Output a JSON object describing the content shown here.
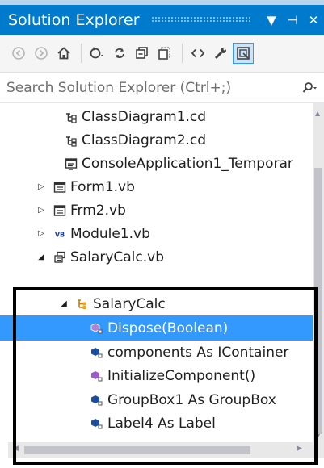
{
  "panel": {
    "title": "Solution Explorer",
    "dropdown_glyph": "▼",
    "pin_glyph": "⊣",
    "close_glyph": "✕",
    "accent_color": "#007acc",
    "selection_color": "#3399ff"
  },
  "toolbar": {
    "items": [
      {
        "name": "back-icon"
      },
      {
        "name": "forward-icon"
      },
      {
        "name": "home-icon"
      },
      {
        "name": "pending-changes-icon"
      },
      {
        "name": "sync-icon"
      },
      {
        "name": "collapse-all-icon"
      },
      {
        "name": "show-all-files-icon"
      },
      {
        "name": "view-code-icon"
      },
      {
        "name": "properties-icon"
      },
      {
        "name": "preview-icon"
      }
    ]
  },
  "search": {
    "placeholder": "Search Solution Explorer (Ctrl+;)",
    "icon": "search-icon"
  },
  "tree": {
    "rows": [
      {
        "label": "ClassDiagram1.cd",
        "icon": "class-diagram-icon",
        "arrow": ""
      },
      {
        "label": "ClassDiagram2.cd",
        "icon": "class-diagram-icon",
        "arrow": ""
      },
      {
        "label": "ConsoleApplication1_Temporar",
        "icon": "temporary-file-icon",
        "arrow": ""
      },
      {
        "label": "Form1.vb",
        "icon": "form-icon",
        "arrow": "▷"
      },
      {
        "label": "Frm2.vb",
        "icon": "form-icon",
        "arrow": "▷"
      },
      {
        "label": "Module1.vb",
        "icon": "vb-module-icon",
        "arrow": "▷"
      },
      {
        "label": "SalaryCalc.vb",
        "icon": "vb-component-icon",
        "arrow": "◢"
      },
      {
        "label": "SalaryCalc",
        "icon": "class-icon",
        "arrow": "◢"
      },
      {
        "label": "Dispose(Boolean)",
        "icon": "protected-method-icon",
        "arrow": ""
      },
      {
        "label": "components As IContainer",
        "icon": "field-icon",
        "arrow": ""
      },
      {
        "label": "InitializeComponent()",
        "icon": "private-method-icon",
        "arrow": ""
      },
      {
        "label": "GroupBox1 As GroupBox",
        "icon": "field-icon",
        "arrow": ""
      },
      {
        "label": "Label4 As Label",
        "icon": "field-icon",
        "arrow": ""
      }
    ]
  }
}
